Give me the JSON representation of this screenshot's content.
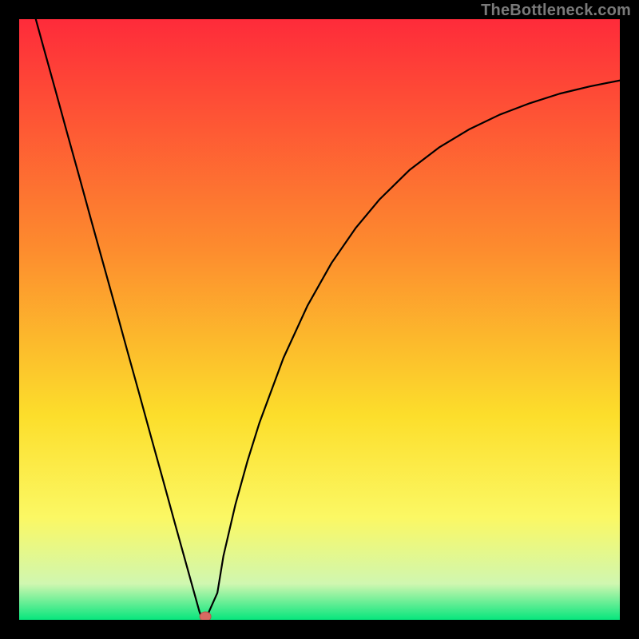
{
  "attribution": "TheBottleneck.com",
  "colors": {
    "gradient_top": "#fe2b3a",
    "gradient_mid1": "#fd8b2e",
    "gradient_mid2": "#fcde2b",
    "gradient_mid3": "#fbf864",
    "gradient_low": "#d0f7b0",
    "gradient_bottom": "#07e67d",
    "curve": "#000000",
    "marker_fill": "#d76a62",
    "marker_stroke": "#b6524b",
    "frame": "#000000"
  },
  "chart_data": {
    "type": "line",
    "x": [
      0.0,
      0.02,
      0.04,
      0.06,
      0.08,
      0.1,
      0.12,
      0.14,
      0.16,
      0.18,
      0.2,
      0.22,
      0.24,
      0.26,
      0.28,
      0.3,
      0.305,
      0.31,
      0.33,
      0.34,
      0.36,
      0.38,
      0.4,
      0.44,
      0.48,
      0.52,
      0.56,
      0.6,
      0.65,
      0.7,
      0.75,
      0.8,
      0.85,
      0.9,
      0.95,
      1.0
    ],
    "series": [
      {
        "name": "bottleneck_curve",
        "values": [
          1.1,
          1.028,
          0.955,
          0.883,
          0.81,
          0.738,
          0.665,
          0.593,
          0.521,
          0.448,
          0.376,
          0.303,
          0.231,
          0.158,
          0.086,
          0.014,
          0.0,
          0.0,
          0.045,
          0.106,
          0.192,
          0.264,
          0.328,
          0.436,
          0.523,
          0.594,
          0.652,
          0.7,
          0.749,
          0.787,
          0.817,
          0.841,
          0.86,
          0.876,
          0.888,
          0.898
        ]
      }
    ],
    "minimum_marker": {
      "x": 0.31,
      "y": 0.0
    },
    "xlim": [
      0,
      1
    ],
    "ylim": [
      0,
      1
    ],
    "xlabel": "",
    "ylabel": "",
    "title": "",
    "grid": false,
    "legend": false
  }
}
